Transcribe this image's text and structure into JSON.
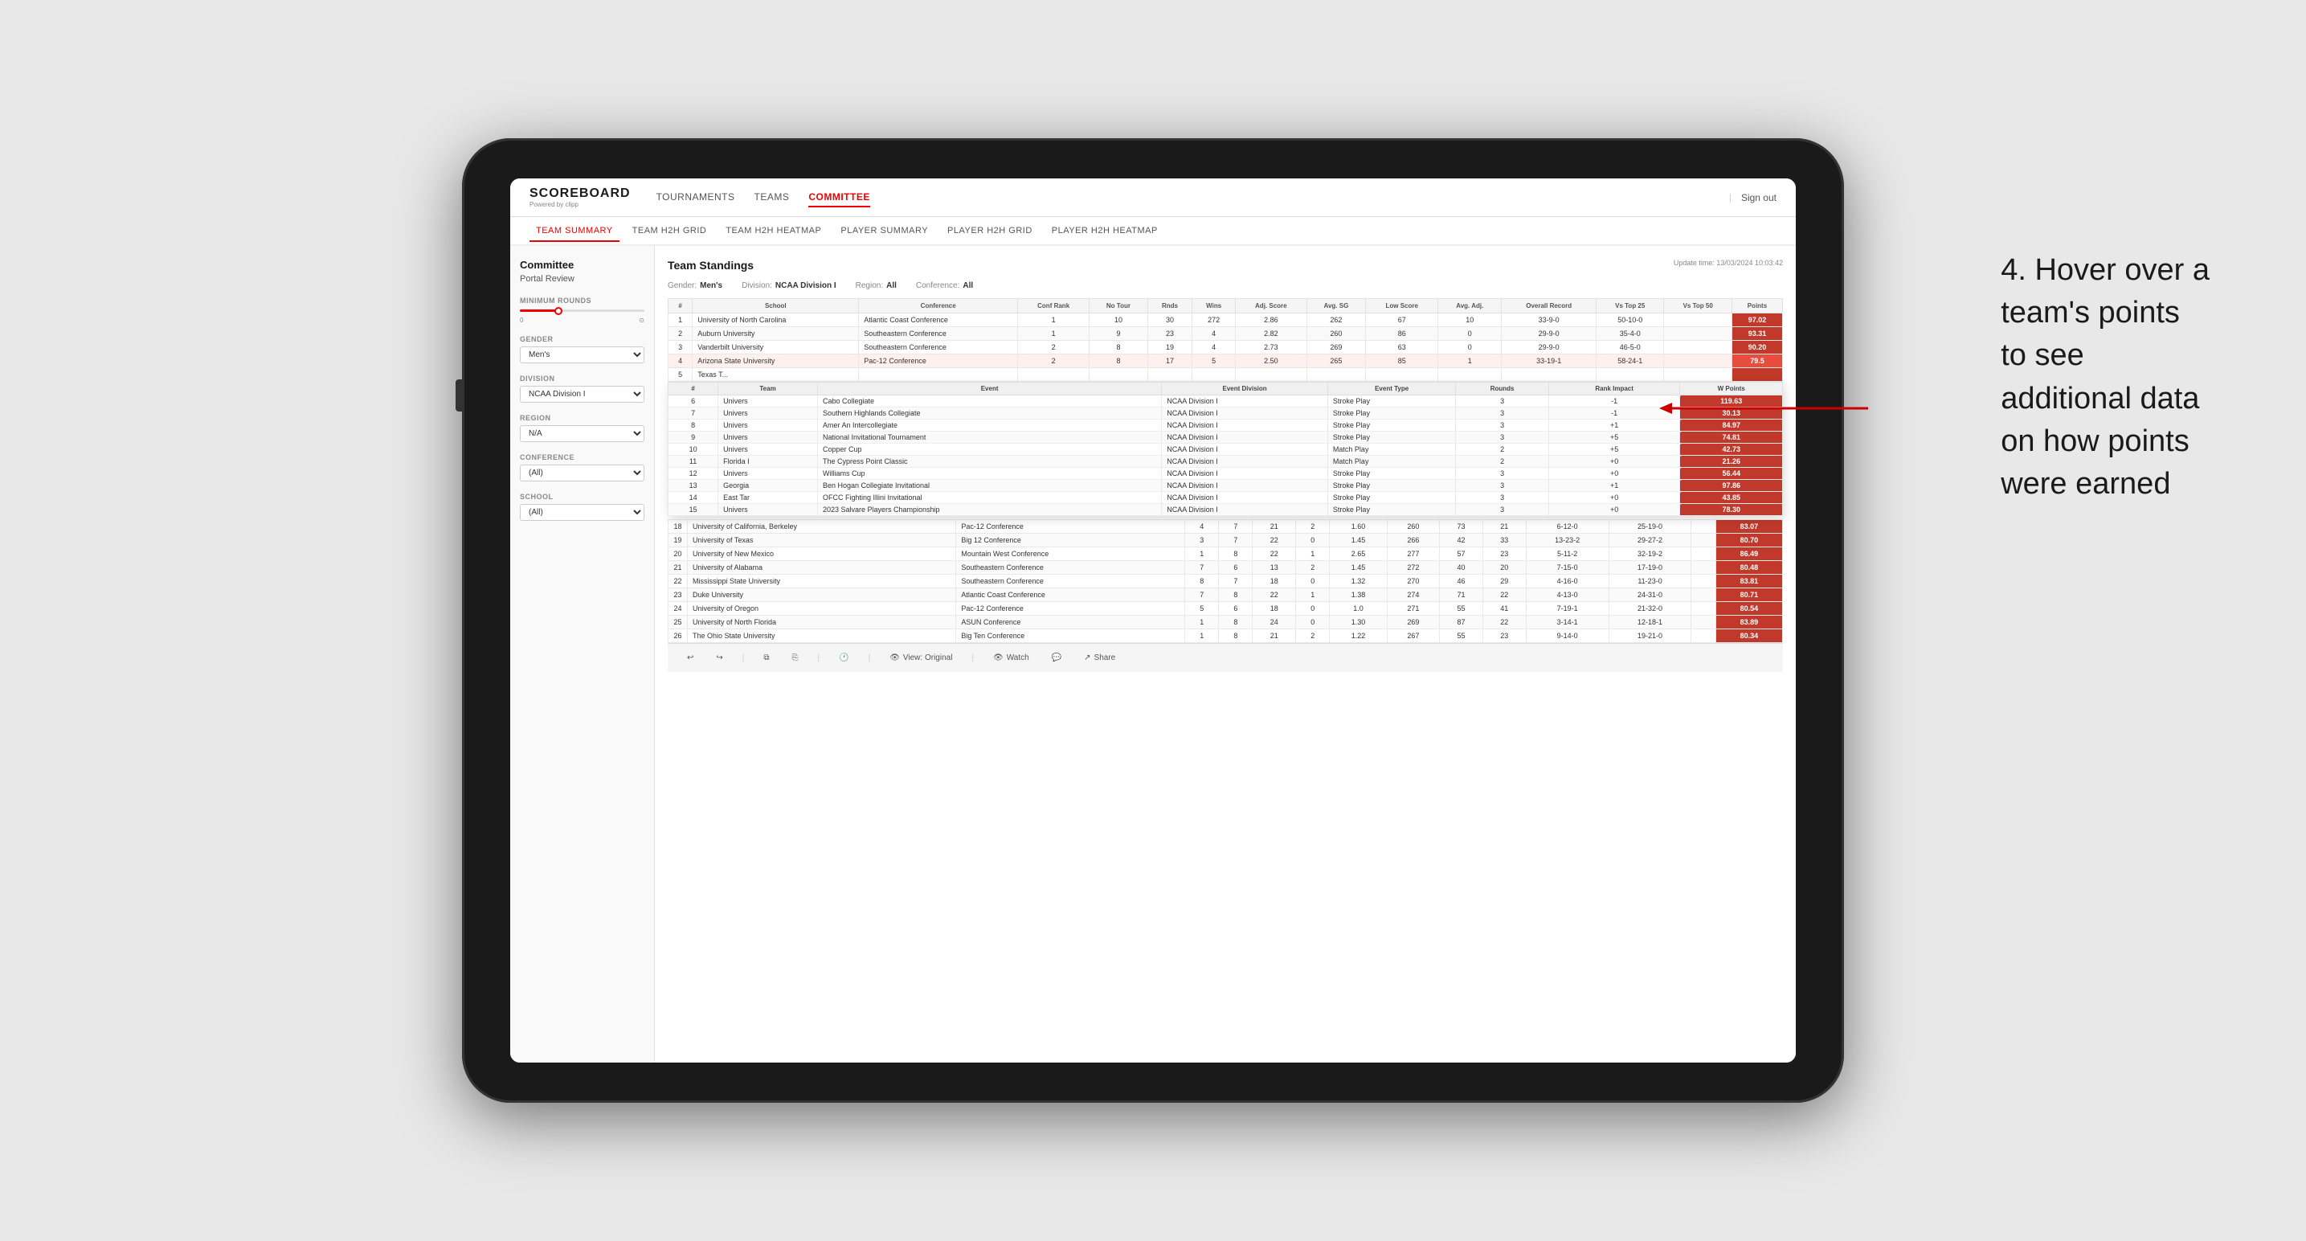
{
  "app": {
    "logo": "SCOREBOARD",
    "logo_sub": "Powered by clipp",
    "sign_out": "Sign out"
  },
  "main_nav": {
    "items": [
      "TOURNAMENTS",
      "TEAMS",
      "COMMITTEE"
    ]
  },
  "sub_nav": {
    "items": [
      "TEAM SUMMARY",
      "TEAM H2H GRID",
      "TEAM H2H HEATMAP",
      "PLAYER SUMMARY",
      "PLAYER H2H GRID",
      "PLAYER H2H HEATMAP"
    ],
    "active": "TEAM SUMMARY"
  },
  "sidebar": {
    "header": "Committee",
    "subheader": "Portal Review",
    "sections": [
      {
        "label": "Minimum Rounds",
        "type": "slider"
      },
      {
        "label": "Gender",
        "type": "select",
        "value": "Men's"
      },
      {
        "label": "Division",
        "type": "select",
        "value": "NCAA Division I"
      },
      {
        "label": "Region",
        "type": "select",
        "value": "N/A"
      },
      {
        "label": "Conference",
        "type": "select",
        "value": "(All)"
      },
      {
        "label": "School",
        "type": "select",
        "value": "(All)"
      }
    ]
  },
  "report": {
    "title": "Team Standings",
    "update_time": "Update time: 13/03/2024 10:03:42",
    "gender": "Men's",
    "division": "NCAA Division I",
    "region": "All",
    "conference": "All"
  },
  "table": {
    "columns": [
      "#",
      "School",
      "Conference",
      "Conf Rank",
      "No Tour",
      "Rnds",
      "Wins",
      "Adj. Score",
      "Avg. SG",
      "Low Score",
      "Avg. Adj.",
      "Overall Record",
      "Vs Top 25",
      "Vs Top 50",
      "Points"
    ],
    "rows": [
      {
        "rank": 1,
        "school": "University of North Carolina",
        "conference": "Atlantic Coast Conference",
        "conf_rank": 1,
        "no_tour": 10,
        "rnds": 30,
        "wins": 272,
        "adj_score": 2.86,
        "avg_sg": 262,
        "low_score": 67,
        "avg_adj": 10,
        "overall": "33-9-0",
        "vs_25": "50-10-0",
        "vs_50": "",
        "points": "97.02",
        "highlight": false
      },
      {
        "rank": 2,
        "school": "Auburn University",
        "conference": "Southeastern Conference",
        "conf_rank": 1,
        "no_tour": 9,
        "rnds": 23,
        "wins": 4,
        "adj_score": 2.82,
        "avg_sg": 260,
        "low_score": 86,
        "avg_adj": 0,
        "overall": "29-9-0",
        "vs_25": "35-4-0",
        "vs_50": "",
        "points": "93.31",
        "highlight": false
      },
      {
        "rank": 3,
        "school": "Vanderbilt University",
        "conference": "Southeastern Conference",
        "conf_rank": 2,
        "no_tour": 8,
        "rnds": 19,
        "wins": 4,
        "adj_score": 2.73,
        "avg_sg": 269,
        "low_score": 63,
        "avg_adj": 0,
        "overall": "29-9-0",
        "vs_25": "46-5-0",
        "vs_50": "",
        "points": "90.20",
        "highlight": false
      },
      {
        "rank": 4,
        "school": "Arizona State University",
        "conference": "Pac-12 Conference",
        "conf_rank": 2,
        "no_tour": 8,
        "rnds": 17,
        "wins": 5,
        "adj_score": 2.5,
        "avg_sg": 265,
        "low_score": 85,
        "avg_adj": 1,
        "overall": "33-19-1",
        "vs_25": "58-24-1",
        "vs_50": "",
        "points": "79.5",
        "highlight": true
      },
      {
        "rank": 5,
        "school": "Texas T...",
        "conference": "",
        "conf_rank": "",
        "no_tour": "",
        "rnds": "",
        "wins": "",
        "adj_score": "",
        "avg_sg": "",
        "low_score": "",
        "avg_adj": "",
        "overall": "",
        "vs_25": "",
        "vs_50": "",
        "points": "",
        "highlight": false
      }
    ]
  },
  "tooltip_table": {
    "columns": [
      "#",
      "Team",
      "Event",
      "Event Division",
      "Event Type",
      "Rounds",
      "Rank Impact",
      "W Points"
    ],
    "rows": [
      {
        "num": 6,
        "team": "Univers",
        "event": "Cabo Collegiate",
        "division": "NCAA Division I",
        "type": "Stroke Play",
        "rounds": 3,
        "impact": "-1",
        "points": "119.63"
      },
      {
        "num": 7,
        "team": "Univers",
        "event": "Southern Highlands Collegiate",
        "division": "NCAA Division I",
        "type": "Stroke Play",
        "rounds": 3,
        "impact": "-1",
        "points": "30.13"
      },
      {
        "num": 8,
        "team": "Univers",
        "event": "Amer An Intercollegiate",
        "division": "NCAA Division I",
        "type": "Stroke Play",
        "rounds": 3,
        "impact": "+1",
        "points": "84.97"
      },
      {
        "num": 9,
        "team": "Univers",
        "event": "National Invitational Tournament",
        "division": "NCAA Division I",
        "type": "Stroke Play",
        "rounds": 3,
        "impact": "+5",
        "points": "74.81"
      },
      {
        "num": 10,
        "team": "Univers",
        "event": "Copper Cup",
        "division": "NCAA Division I",
        "type": "Match Play",
        "rounds": 2,
        "impact": "+5",
        "points": "42.73"
      },
      {
        "num": 11,
        "team": "Florida I",
        "event": "The Cypress Point Classic",
        "division": "NCAA Division I",
        "type": "Match Play",
        "rounds": 2,
        "impact": "+0",
        "points": "21.26"
      },
      {
        "num": 12,
        "team": "Univers",
        "event": "Williams Cup",
        "division": "NCAA Division I",
        "type": "Stroke Play",
        "rounds": 3,
        "impact": "+0",
        "points": "56.44"
      },
      {
        "num": 13,
        "team": "Georgia",
        "event": "Ben Hogan Collegiate Invitational",
        "division": "NCAA Division I",
        "type": "Stroke Play",
        "rounds": 3,
        "impact": "+1",
        "points": "97.86"
      },
      {
        "num": 14,
        "team": "East Tar",
        "event": "OFCC Fighting Illini Invitational",
        "division": "NCAA Division I",
        "type": "Stroke Play",
        "rounds": 3,
        "impact": "+0",
        "points": "43.85"
      },
      {
        "num": 15,
        "team": "Univers",
        "event": "2023 Salvare Players Championship",
        "division": "NCAA Division I",
        "type": "Stroke Play",
        "rounds": 3,
        "impact": "+0",
        "points": "78.30"
      }
    ]
  },
  "lower_rows": [
    {
      "rank": 18,
      "school": "University of California, Berkeley",
      "conference": "Pac-12 Conference",
      "conf_rank": 4,
      "no_tour": 7,
      "rnds": 21,
      "wins": 2,
      "adj_score": 1.6,
      "avg_sg": 260,
      "low_score": 73,
      "avg_adj": 21,
      "overall": "6-12-0",
      "vs_25": "25-19-0",
      "vs_50": "",
      "points": "83.07"
    },
    {
      "rank": 19,
      "school": "University of Texas",
      "conference": "Big 12 Conference",
      "conf_rank": 3,
      "no_tour": 7,
      "rnds": 22,
      "wins": 0,
      "adj_score": 1.45,
      "avg_sg": 266,
      "low_score": 42,
      "avg_adj": 33,
      "overall": "13-23-2",
      "vs_25": "29-27-2",
      "vs_50": "",
      "points": "80.70"
    },
    {
      "rank": 20,
      "school": "University of New Mexico",
      "conference": "Mountain West Conference",
      "conf_rank": 1,
      "no_tour": 8,
      "rnds": 22,
      "wins": 1,
      "adj_score": 2.65,
      "avg_sg": 277,
      "low_score": 57,
      "avg_adj": 23,
      "overall": "5-11-2",
      "vs_25": "32-19-2",
      "vs_50": "",
      "points": "86.49"
    },
    {
      "rank": 21,
      "school": "University of Alabama",
      "conference": "Southeastern Conference",
      "conf_rank": 7,
      "no_tour": 6,
      "rnds": 13,
      "wins": 2,
      "adj_score": 1.45,
      "avg_sg": 272,
      "low_score": 40,
      "avg_adj": 20,
      "overall": "7-15-0",
      "vs_25": "17-19-0",
      "vs_50": "",
      "points": "80.48"
    },
    {
      "rank": 22,
      "school": "Mississippi State University",
      "conference": "Southeastern Conference",
      "conf_rank": 8,
      "no_tour": 7,
      "rnds": 18,
      "wins": 0,
      "adj_score": 1.32,
      "avg_sg": 270,
      "low_score": 46,
      "avg_adj": 29,
      "overall": "4-16-0",
      "vs_25": "11-23-0",
      "vs_50": "",
      "points": "83.81"
    },
    {
      "rank": 23,
      "school": "Duke University",
      "conference": "Atlantic Coast Conference",
      "conf_rank": 7,
      "no_tour": 8,
      "rnds": 22,
      "wins": 1,
      "adj_score": 1.38,
      "avg_sg": 274,
      "low_score": 71,
      "avg_adj": 22,
      "overall": "4-13-0",
      "vs_25": "24-31-0",
      "vs_50": "",
      "points": "80.71"
    },
    {
      "rank": 24,
      "school": "University of Oregon",
      "conference": "Pac-12 Conference",
      "conf_rank": 5,
      "no_tour": 6,
      "rnds": 18,
      "wins": 0,
      "adj_score": 1,
      "avg_sg": 271,
      "low_score": 55,
      "avg_adj": 41,
      "overall": "7-19-1",
      "vs_25": "21-32-0",
      "vs_50": "",
      "points": "80.54"
    },
    {
      "rank": 25,
      "school": "University of North Florida",
      "conference": "ASUN Conference",
      "conf_rank": 1,
      "no_tour": 8,
      "rnds": 24,
      "wins": 0,
      "adj_score": 1.3,
      "avg_sg": 269,
      "low_score": 87,
      "avg_adj": 22,
      "overall": "3-14-1",
      "vs_25": "12-18-1",
      "vs_50": "",
      "points": "83.89"
    },
    {
      "rank": 26,
      "school": "The Ohio State University",
      "conference": "Big Ten Conference",
      "conf_rank": 1,
      "no_tour": 8,
      "rnds": 21,
      "wins": 2,
      "adj_score": 1.22,
      "avg_sg": 267,
      "low_score": 55,
      "avg_adj": 23,
      "overall": "9-14-0",
      "vs_25": "19-21-0",
      "vs_50": "",
      "points": "80.34"
    }
  ],
  "toolbar": {
    "undo": "↩",
    "redo": "↪",
    "view_original": "View: Original",
    "watch": "Watch",
    "share": "Share"
  },
  "annotation": {
    "text": "4. Hover over a\nteam's points\nto see\nadditional data\non how points\nwere earned"
  }
}
